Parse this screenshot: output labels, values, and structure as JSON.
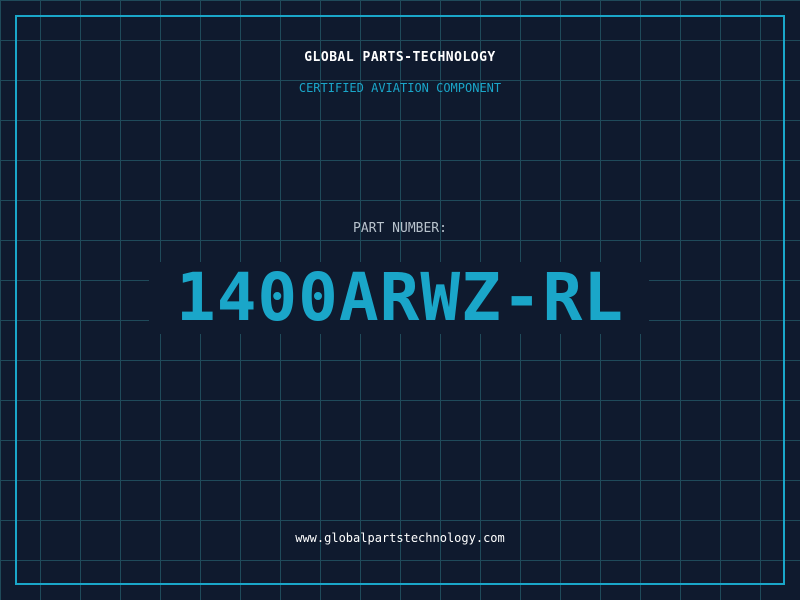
{
  "label": {
    "company": "GLOBAL PARTS-TECHNOLOGY",
    "tagline": "CERTIFIED AVIATION COMPONENT",
    "part_number_label": "PART NUMBER:",
    "part_number": "1400ARWZ-RL",
    "website": "www.globalpartstechnology.com"
  },
  "colors": {
    "background": "#0f1a2e",
    "grid": "#1f4a5a",
    "accent": "#1aa6c9",
    "text": "#ffffff",
    "muted": "#b8c2cc"
  }
}
